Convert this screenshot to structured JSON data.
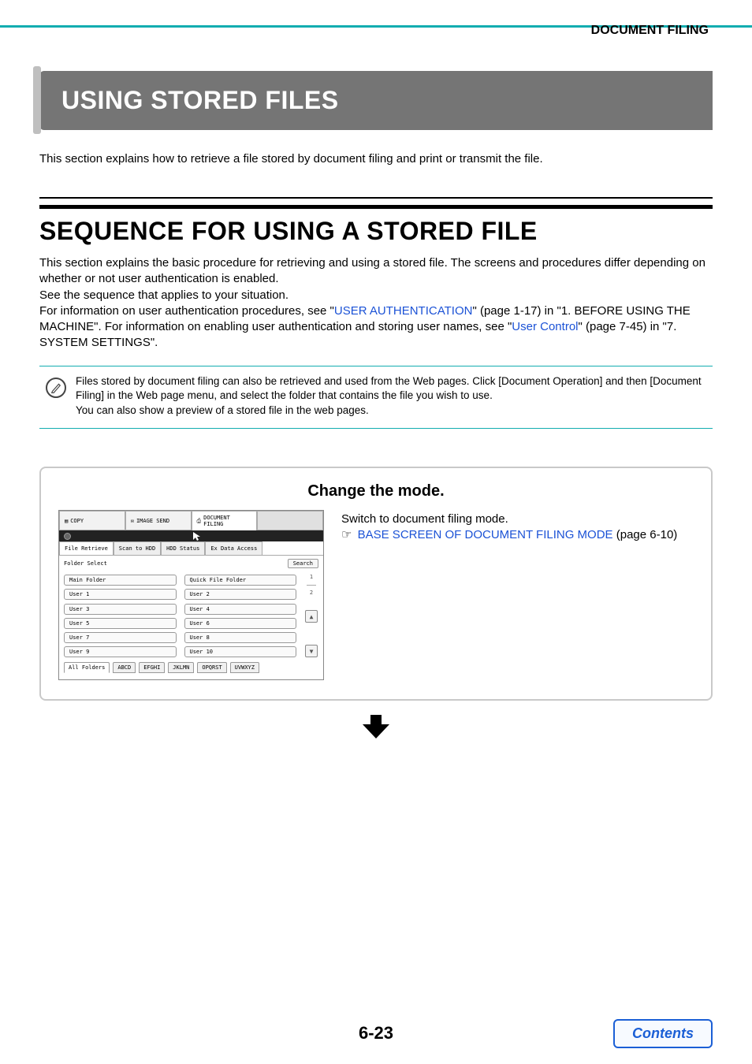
{
  "breadcrumb": "DOCUMENT FILING",
  "title": "USING STORED FILES",
  "intro": "This section explains how to retrieve a file stored by document filing and print or transmit the file.",
  "h2": "SEQUENCE FOR USING A STORED FILE",
  "para": {
    "p1": "This section explains the basic procedure for retrieving and using a stored file. The screens and procedures differ depending on whether or not user authentication is enabled.",
    "p2": "See the sequence that applies to your situation.",
    "p3a": "For information on user authentication procedures, see \"",
    "p3link": "USER AUTHENTICATION",
    "p3b": "\" (page 1-17) in \"1. BEFORE USING THE MACHINE\". For information on enabling user authentication and storing user names, see \"",
    "p3link2": "User Control",
    "p3c": "\" (page 7-45) in \"7. SYSTEM SETTINGS\"."
  },
  "note": {
    "l1": "Files stored by document filing can also be retrieved and used from the Web pages. Click [Document Operation] and then [Document Filing] in the Web page menu, and select the folder that contains the file you wish to use.",
    "l2": "You can also show a preview of a stored file in the web pages."
  },
  "step": {
    "title": "Change the mode.",
    "right1": "Switch to document filing mode.",
    "rightLink": "BASE SCREEN OF DOCUMENT FILING MODE",
    "rightTail": " (page 6-10)"
  },
  "mini": {
    "tabs": {
      "copy": "COPY",
      "image_send": "IMAGE SEND",
      "doc_filing": "DOCUMENT\nFILING"
    },
    "tabs2": {
      "file_retrieve": "File Retrieve",
      "scan_hdd": "Scan to HDD",
      "hdd_status": "HDD Status",
      "ex_data": "Ex Data Access"
    },
    "folder_select": "Folder Select",
    "search": "Search",
    "main_folder": "Main Folder",
    "quick_file_folder": "Quick File Folder",
    "users": [
      "User 1",
      "User 2",
      "User 3",
      "User 4",
      "User 5",
      "User 6",
      "User 7",
      "User 8",
      "User 9",
      "User 10"
    ],
    "pager": {
      "top": "1",
      "bot": "2"
    },
    "btabs": [
      "All Folders",
      "ABCD",
      "EFGHI",
      "JKLMN",
      "OPQRST",
      "UVWXYZ"
    ]
  },
  "page_number": "6-23",
  "contents": "Contents"
}
